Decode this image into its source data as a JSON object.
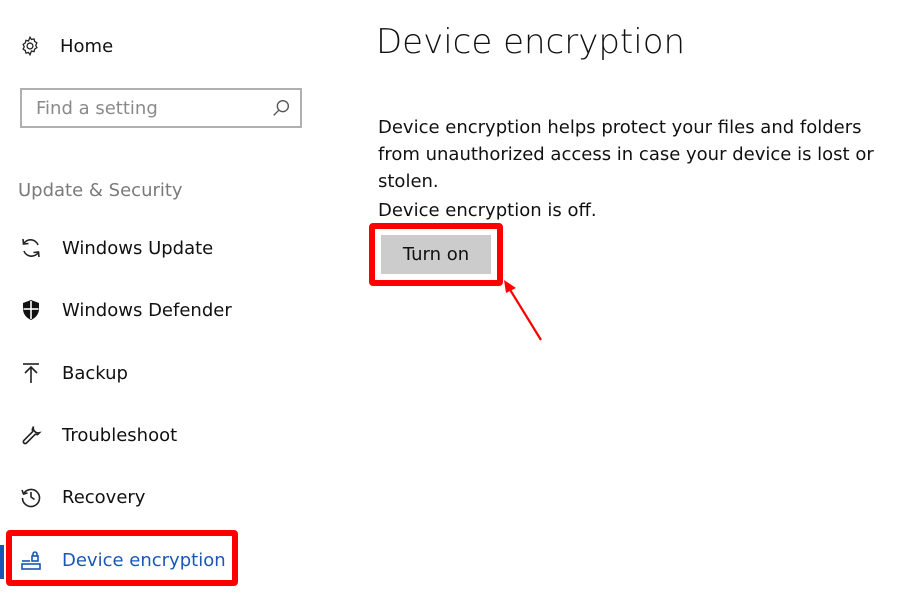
{
  "sidebar": {
    "home_label": "Home",
    "search_placeholder": "Find a setting",
    "section_title": "Update & Security",
    "items": [
      {
        "label": "Windows Update",
        "icon": "refresh-icon"
      },
      {
        "label": "Windows Defender",
        "icon": "shield-icon"
      },
      {
        "label": "Backup",
        "icon": "upload-icon"
      },
      {
        "label": "Troubleshoot",
        "icon": "wrench-icon"
      },
      {
        "label": "Recovery",
        "icon": "history-icon"
      },
      {
        "label": "Device encryption",
        "icon": "encryption-icon",
        "active": true
      }
    ]
  },
  "main": {
    "title": "Device encryption",
    "description": "Device encryption helps protect your files and folders from unauthorized access in case your device is lost or stolen.",
    "status": "Device encryption is off.",
    "turn_on_label": "Turn on"
  },
  "colors": {
    "accent": "#1a57b5",
    "highlight": "#ff0000",
    "button_bg": "#cccccc",
    "muted_text": "#7a7a7a"
  }
}
